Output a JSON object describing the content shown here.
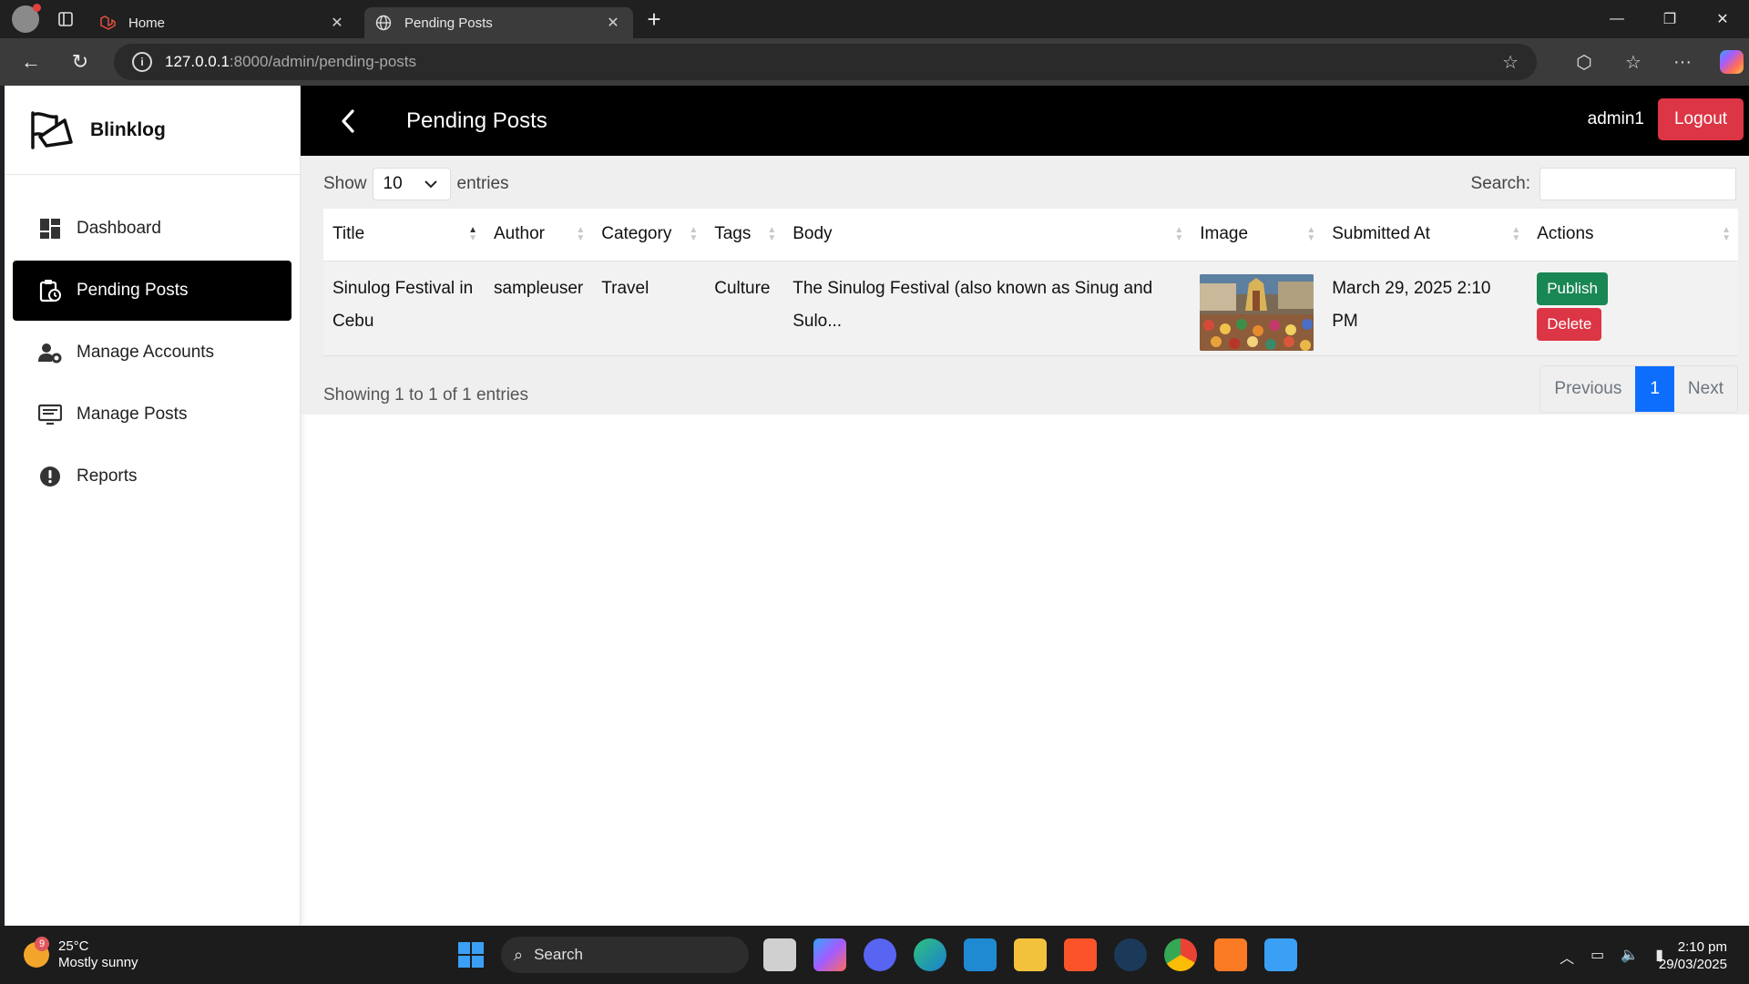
{
  "browser": {
    "tabs": [
      {
        "title": "Home",
        "active": false
      },
      {
        "title": "Pending Posts",
        "active": true
      }
    ],
    "url_host": "127.0.0.1",
    "url_path": ":8000/admin/pending-posts"
  },
  "sidebar": {
    "brand": "Blinklog",
    "items": [
      {
        "label": "Dashboard",
        "icon": "dashboard-icon",
        "active": false
      },
      {
        "label": "Pending Posts",
        "icon": "clipboard-clock-icon",
        "active": true
      },
      {
        "label": "Manage Accounts",
        "icon": "users-gear-icon",
        "active": false
      },
      {
        "label": "Manage Posts",
        "icon": "monitor-list-icon",
        "active": false
      },
      {
        "label": "Reports",
        "icon": "exclamation-circle-icon",
        "active": false
      }
    ]
  },
  "header": {
    "title": "Pending Posts",
    "user": "admin1",
    "logout_label": "Logout"
  },
  "table_controls": {
    "show_label": "Show",
    "page_length": "10",
    "entries_label": "entries",
    "search_label": "Search:",
    "search_value": ""
  },
  "table": {
    "columns": [
      "Title",
      "Author",
      "Category",
      "Tags",
      "Body",
      "Image",
      "Submitted At",
      "Actions"
    ],
    "rows": [
      {
        "title": "Sinulog Festival in Cebu",
        "author": "sampleuser",
        "category": "Travel",
        "tags": "Culture",
        "body": "The Sinulog Festival (also known as Sinug and Sulo...",
        "submitted_at": "March 29, 2025 2:10 PM",
        "publish_label": "Publish",
        "delete_label": "Delete"
      }
    ],
    "info": "Showing 1 to 1 of 1 entries",
    "pagination": {
      "previous": "Previous",
      "current": "1",
      "next": "Next"
    }
  },
  "taskbar": {
    "weather_temp": "25°C",
    "weather_desc": "Mostly sunny",
    "weather_badge": "9",
    "search_label": "Search",
    "time": "2:10 pm",
    "date": "29/03/2025"
  },
  "colors": {
    "accent_blue": "#0d6efd",
    "danger": "#dc3545",
    "success": "#198754",
    "header_bg": "#000000"
  }
}
